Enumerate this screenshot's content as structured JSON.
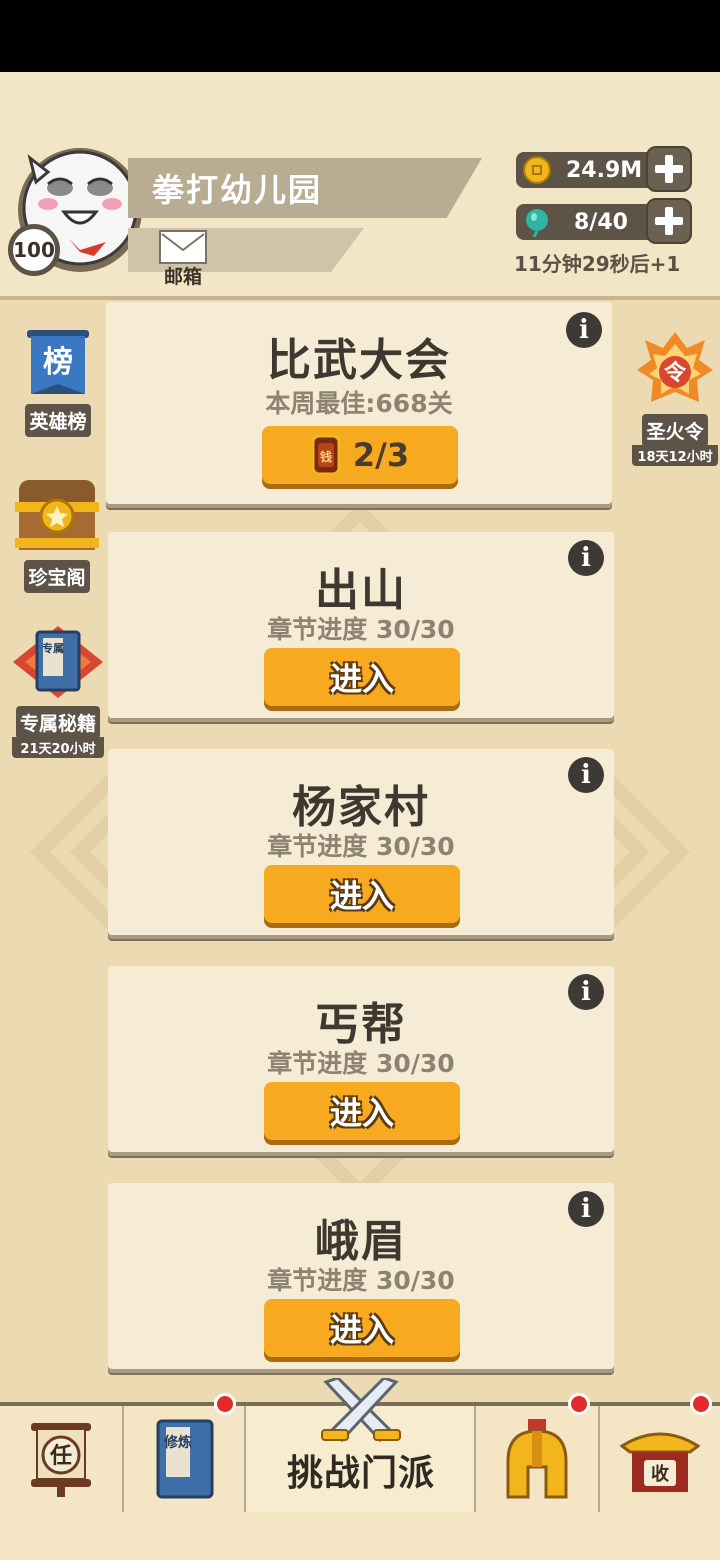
{
  "player": {
    "name": "拳打幼儿园",
    "level": "100",
    "mail_label": "邮箱"
  },
  "resources": {
    "coins": "24.9M",
    "stamina": "8/40",
    "timer": "11分钟29秒后+1"
  },
  "side_left": [
    {
      "label": "英雄榜",
      "icon": "ranking-scroll-icon",
      "glyph": "榜"
    },
    {
      "label": "珍宝阁",
      "icon": "treasure-chest-icon"
    },
    {
      "label": "专属秘籍",
      "sub": "21天20小时",
      "icon": "secret-book-icon",
      "glyph": "专属"
    }
  ],
  "side_right": [
    {
      "label": "圣火令",
      "sub": "18天12小时",
      "icon": "holy-fire-order-icon",
      "glyph": "令"
    }
  ],
  "cards": [
    {
      "title": "比武大会",
      "subtitle": "本周最佳:668关",
      "button": "2/3",
      "button_icon": "coin-token-icon",
      "token_glyph": "钱"
    },
    {
      "title": "出山",
      "subtitle": "章节进度 30/30",
      "button": "进入"
    },
    {
      "title": "杨家村",
      "subtitle": "章节进度 30/30",
      "button": "进入"
    },
    {
      "title": "丐帮",
      "subtitle": "章节进度 30/30",
      "button": "进入"
    },
    {
      "title": "峨眉",
      "subtitle": "章节进度 30/30",
      "button": "进入"
    }
  ],
  "info_glyph": "i",
  "bottom_nav": {
    "task_glyph": "任",
    "cultivate_glyph": "修炼",
    "center_label": "挑战门派",
    "collect_glyph": "收"
  },
  "colors": {
    "background": "#ecdab3",
    "card": "#f6ecd5",
    "button": "#f7aa1f",
    "dark": "#5d5447",
    "badge": "#e22b2b"
  }
}
